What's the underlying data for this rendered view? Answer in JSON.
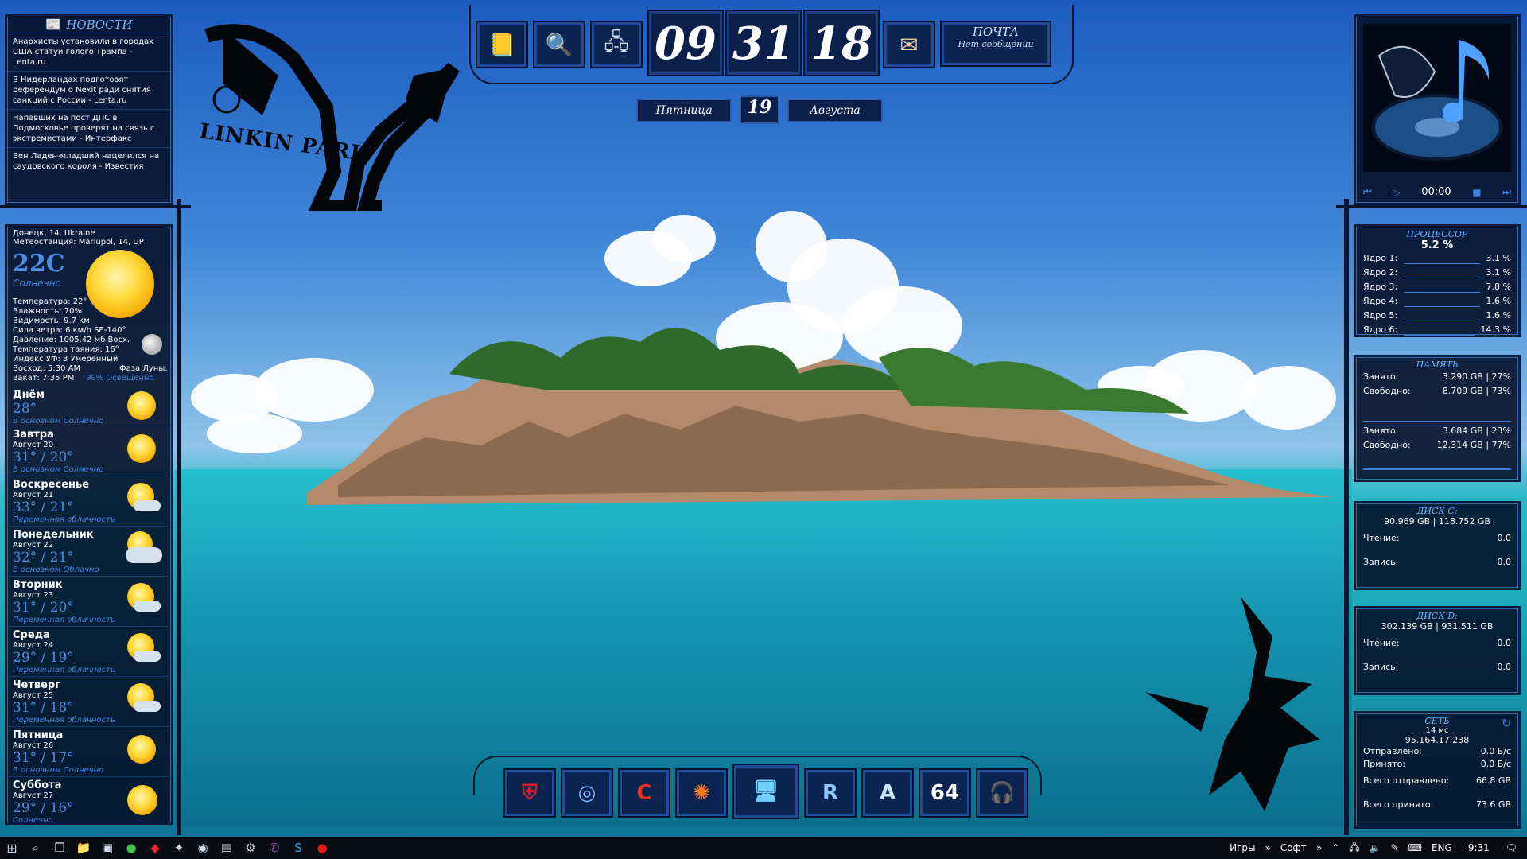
{
  "clock": {
    "hours": "09",
    "minutes": "31",
    "seconds": "18",
    "weekday": "Пятница",
    "day": "19",
    "month": "Августа"
  },
  "mail": {
    "title": "ПОЧТА",
    "status": "Нет сообщений"
  },
  "news": {
    "title": "НОВОСТИ",
    "items": [
      "Анархисты установили в городах США статуи голого Трампа - Lenta.ru",
      "В Нидерландах подготовят референдум о Nexit ради снятия санкций с России - Lenta.ru",
      "Напавших на пост ДПС в Подмосковье проверят на связь с экстремистами - Интерфакс",
      "Бен Ладен-младший нацелился на саудовского короля - Известия"
    ]
  },
  "weather": {
    "location": "Донецк, 14, Ukraine",
    "station": "Метеостанция: Mariupol, 14, UP",
    "temp": "22C",
    "condition": "Солнечно",
    "details": [
      "Температура: 22°",
      "Влажность: 70%",
      "Видимость: 9.7 км",
      "Сила ветра: 6 км/h SE-140°",
      "Давление: 1005.42 мб Восх.",
      "Температура таяния: 16°",
      "Индекс УФ: 3 Умеренный",
      "Восход: 5:30 AM",
      "Закат: 7:35 PM"
    ],
    "moon_phase": "Фаза Луны:",
    "moon_light": "99% Освещенно",
    "forecast": [
      {
        "day": "Днём",
        "date": "",
        "temp": "28°",
        "cond": "В основном Солнечно",
        "cloud": false
      },
      {
        "day": "Завтра",
        "date": "Август 20",
        "temp": "31° / 20°",
        "cond": "В основном Солнечно",
        "cloud": false
      },
      {
        "day": "Воскресенье",
        "date": "Август 21",
        "temp": "33° / 21°",
        "cond": "Переменная облачность",
        "cloud": true
      },
      {
        "day": "Понедельник",
        "date": "Август 22",
        "temp": "32° / 21°",
        "cond": "В основном Облачно",
        "cloud": true
      },
      {
        "day": "Вторник",
        "date": "Август 23",
        "temp": "31° / 20°",
        "cond": "Переменная облачность",
        "cloud": true
      },
      {
        "day": "Среда",
        "date": "Август 24",
        "temp": "29° / 19°",
        "cond": "Переменная облачность",
        "cloud": true
      },
      {
        "day": "Четверг",
        "date": "Август 25",
        "temp": "31° / 18°",
        "cond": "Переменная облачность",
        "cloud": true
      },
      {
        "day": "Пятница",
        "date": "Август 26",
        "temp": "31° / 17°",
        "cond": "В основном Солнечно",
        "cloud": false
      },
      {
        "day": "Суббота",
        "date": "Август 27",
        "temp": "29° / 16°",
        "cond": "Солнечно",
        "cloud": false
      }
    ]
  },
  "player": {
    "time": "00:00"
  },
  "cpu": {
    "title": "ПРОЦЕССОР",
    "total": "5.2 %",
    "cores": [
      {
        "label": "Ядро 1:",
        "value": "3.1 %"
      },
      {
        "label": "Ядро 2:",
        "value": "3.1 %"
      },
      {
        "label": "Ядро 3:",
        "value": "7.8 %"
      },
      {
        "label": "Ядро 4:",
        "value": "1.6 %"
      },
      {
        "label": "Ядро 5:",
        "value": "1.6 %"
      },
      {
        "label": "Ядро 6:",
        "value": "14.3 %"
      }
    ]
  },
  "memory": {
    "title": "ПАМЯТЬ",
    "ram": {
      "used_label": "Занято:",
      "used": "3.290 GB | 27%",
      "free_label": "Свободно:",
      "free": "8.709 GB | 73%"
    },
    "swap": {
      "used_label": "Занято:",
      "used": "3.684 GB | 23%",
      "free_label": "Свободно:",
      "free": "12.314 GB | 77%"
    }
  },
  "disk_c": {
    "title": "ДИСК C:",
    "usage": "90.969 GB | 118.752 GB",
    "read_label": "Чтение:",
    "read": "0.0",
    "write_label": "Запись:",
    "write": "0.0"
  },
  "disk_d": {
    "title": "ДИСК D:",
    "usage": "302.139 GB | 931.511 GB",
    "read_label": "Чтение:",
    "read": "0.0",
    "write_label": "Запись:",
    "write": "0.0"
  },
  "network": {
    "title": "СЕТЬ",
    "ping": "14 мс",
    "ip": "95.164.17.238",
    "sent_label": "Отправлено:",
    "sent": "0.0 Б/с",
    "recv_label": "Принято:",
    "recv": "0.0 Б/с",
    "total_sent_label": "Всего отправлено:",
    "total_sent": "66.8 GB",
    "total_recv_label": "Всего принято:",
    "total_recv": "73.6 GB"
  },
  "logo": {
    "text": "LINKIN PARK"
  },
  "dock": {
    "items": [
      {
        "name": "shield-app-icon",
        "glyph": "⛨",
        "color": "#d8202a"
      },
      {
        "name": "disc-app-icon",
        "glyph": "◎",
        "color": "#7fb6ff"
      },
      {
        "name": "ccleaner-icon",
        "glyph": "C",
        "color": "#e0341c"
      },
      {
        "name": "settings-gear-icon",
        "glyph": "✺",
        "color": "#ff7a18"
      },
      {
        "name": "computer-icon",
        "glyph": "🖥",
        "color": "#6fd0ff"
      },
      {
        "name": "recycle-app-icon",
        "glyph": "R",
        "color": "#8cc8ff"
      },
      {
        "name": "font-app-icon",
        "glyph": "A",
        "color": "#cfe4ff"
      },
      {
        "name": "aida64-icon",
        "glyph": "64",
        "color": "#ffffff"
      },
      {
        "name": "headphones-icon",
        "glyph": "🎧",
        "color": "#8aa4c8"
      }
    ]
  },
  "taskbar": {
    "toolbar1": "Игры",
    "toolbar2": "Софт",
    "lang": "ENG",
    "time": "9:31"
  }
}
